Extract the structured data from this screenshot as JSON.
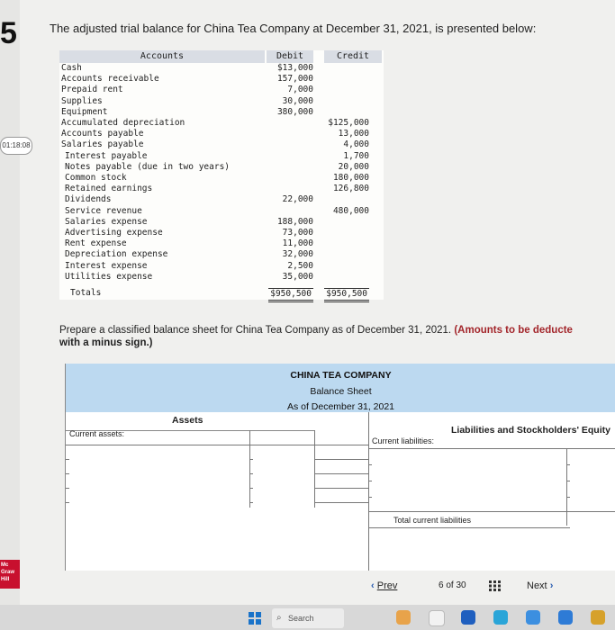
{
  "sidebar": {
    "brand_digit": "5",
    "timer": "01:18:08",
    "logo_lines": [
      "Mc",
      "Graw",
      "Hill"
    ]
  },
  "question": {
    "intro": "The adjusted trial balance for China Tea Company at December 31, 2021, is presented below:",
    "prompt_main": "Prepare a classified balance sheet for China Tea Company as of December 31, 2021.",
    "prompt_bold": "(Amounts to be deducte",
    "prompt_bold2": "with a minus sign.)"
  },
  "trial_balance": {
    "headers": {
      "accounts": "Accounts",
      "debit": "Debit",
      "credit": "Credit"
    },
    "rows": [
      {
        "account": "Cash",
        "debit": "$13,000",
        "credit": ""
      },
      {
        "account": "Accounts receivable",
        "debit": "157,000",
        "credit": ""
      },
      {
        "account": "Prepaid rent",
        "debit": "7,000",
        "credit": ""
      },
      {
        "account": "Supplies",
        "debit": "30,000",
        "credit": ""
      },
      {
        "account": "Equipment",
        "debit": "380,000",
        "credit": ""
      },
      {
        "account": "Accumulated depreciation",
        "debit": "",
        "credit": "$125,000"
      },
      {
        "account": "Accounts payable",
        "debit": "",
        "credit": "13,000"
      },
      {
        "account": "Salaries payable",
        "debit": "",
        "credit": "4,000"
      },
      {
        "account": "Interest payable",
        "debit": "",
        "credit": "1,700"
      },
      {
        "account": "Notes payable (due in two years)",
        "debit": "",
        "credit": "20,000"
      },
      {
        "account": "Common stock",
        "debit": "",
        "credit": "180,000"
      },
      {
        "account": "Retained earnings",
        "debit": "",
        "credit": "126,800"
      },
      {
        "account": "Dividends",
        "debit": "22,000",
        "credit": ""
      },
      {
        "account": "Service revenue",
        "debit": "",
        "credit": "480,000"
      },
      {
        "account": "Salaries expense",
        "debit": "188,000",
        "credit": ""
      },
      {
        "account": "Advertising expense",
        "debit": "73,000",
        "credit": ""
      },
      {
        "account": "Rent expense",
        "debit": "11,000",
        "credit": ""
      },
      {
        "account": "Depreciation expense",
        "debit": "32,000",
        "credit": ""
      },
      {
        "account": "Interest expense",
        "debit": "2,500",
        "credit": ""
      },
      {
        "account": "Utilities expense",
        "debit": "35,000",
        "credit": ""
      }
    ],
    "totals": {
      "label": "Totals",
      "debit": "$950,500",
      "credit": "$950,500"
    }
  },
  "balance_sheet": {
    "company": "CHINA TEA COMPANY",
    "title": "Balance Sheet",
    "date": "As of December 31, 2021",
    "assets_heading": "Assets",
    "liabilities_heading": "Liabilities and Stockholders' Equity",
    "current_assets_label": "Current assets:",
    "current_liabilities_label": "Current liabilities:",
    "total_current_liabilities_label": "Total current liabilities"
  },
  "navigation": {
    "prev_label": "Prev",
    "page_current": "6",
    "page_of": "of",
    "page_total": "30",
    "next_label": "Next"
  },
  "taskbar": {
    "search_label": "Search"
  },
  "colors": {
    "header_blue": "#bcd9f0",
    "link_blue": "#2a5db0",
    "accent_red": "#a3262b",
    "table_header_gray": "#d9dde4"
  }
}
